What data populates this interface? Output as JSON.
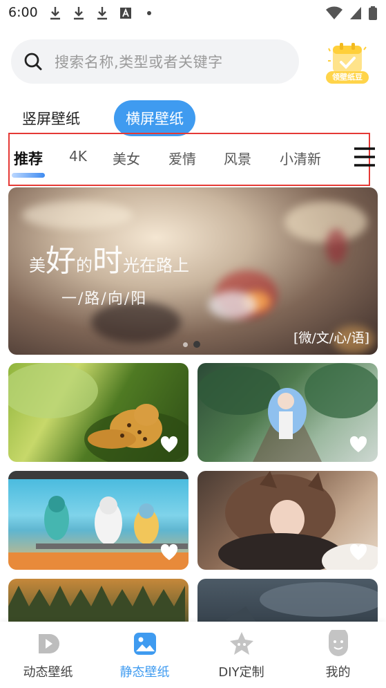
{
  "status_bar": {
    "time": "6:00",
    "icons": [
      "download-icon",
      "download-icon",
      "download-icon",
      "font-icon",
      "dot-icon",
      "wifi-icon",
      "signal-icon",
      "battery-icon"
    ]
  },
  "search": {
    "placeholder": "搜索名称,类型或者关键字"
  },
  "coupon": {
    "label": "领壁纸豆"
  },
  "mode_tabs": {
    "portrait": "竖屏壁纸",
    "landscape": "横屏壁纸",
    "active": "landscape"
  },
  "category_tabs": [
    {
      "label": "推荐",
      "active": true
    },
    {
      "label": "4K",
      "active": false
    },
    {
      "label": "美女",
      "active": false
    },
    {
      "label": "爱情",
      "active": false
    },
    {
      "label": "风景",
      "active": false
    },
    {
      "label": "小清新",
      "active": false
    }
  ],
  "banner": {
    "line1": [
      "美",
      "好",
      "的",
      "时",
      "光",
      "在",
      "路",
      "上"
    ],
    "line2": "一/路/向/阳",
    "caption": "[微/文/心/语]",
    "pages": 2,
    "current_page": 2
  },
  "wallpapers": [
    {
      "subject": "leopard in grass"
    },
    {
      "subject": "blue-haired anime girl"
    },
    {
      "subject": "three anime girls at seaside"
    },
    {
      "subject": "anime cat-eared girl"
    },
    {
      "subject": "autumn forest"
    },
    {
      "subject": "dark cloudy sky"
    }
  ],
  "bottom_nav": [
    {
      "label": "动态壁纸",
      "icon": "play-icon",
      "active": false
    },
    {
      "label": "静态壁纸",
      "icon": "image-icon",
      "active": true
    },
    {
      "label": "DIY定制",
      "icon": "star-icon",
      "active": false
    },
    {
      "label": "我的",
      "icon": "face-icon",
      "active": false
    }
  ],
  "colors": {
    "accent": "#3f9bf0",
    "highlight_box": "#e53935"
  }
}
